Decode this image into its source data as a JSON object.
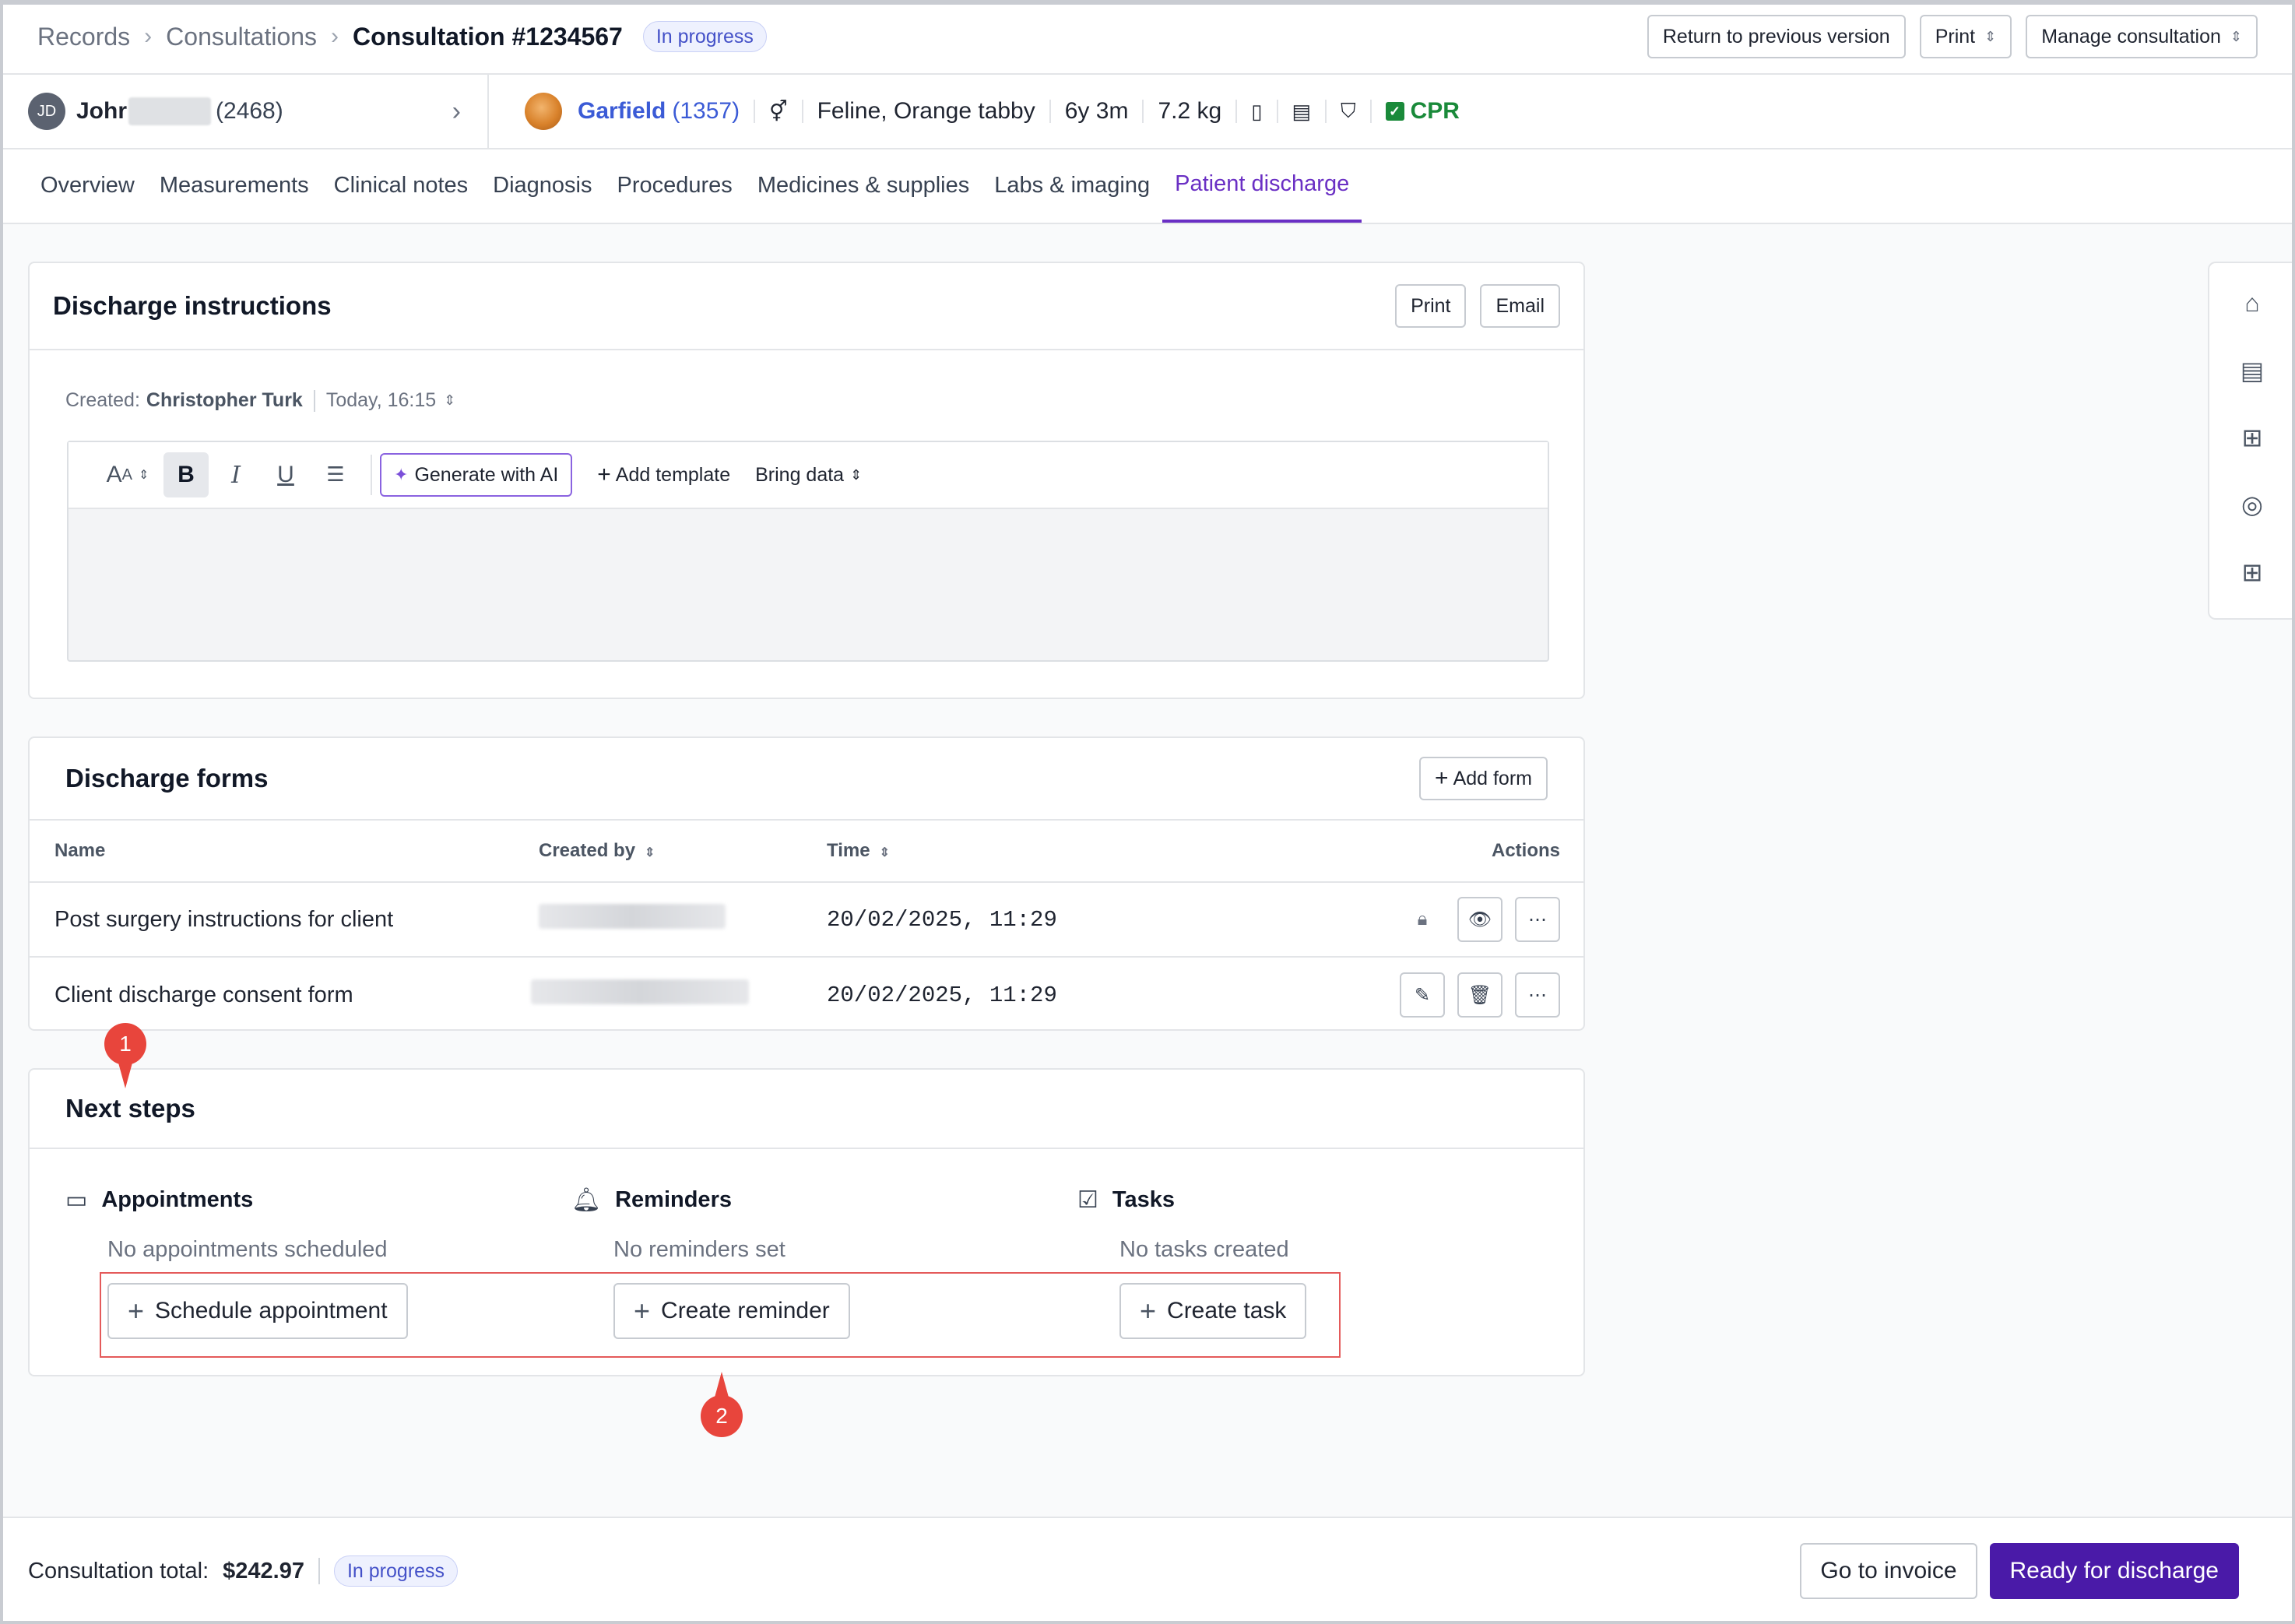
{
  "breadcrumb": {
    "items": [
      "Records",
      "Consultations"
    ],
    "current": "Consultation #1234567",
    "status": "In progress"
  },
  "header_actions": {
    "return_label": "Return to previous version",
    "print_label": "Print",
    "manage_label": "Manage consultation"
  },
  "client": {
    "initials": "JD",
    "name": "Johr",
    "id": "(2468)"
  },
  "patient": {
    "name": "Garfield",
    "id": "(1357)",
    "species": "Feline, Orange tabby",
    "age": "6y 3m",
    "weight": "7.2 kg",
    "cpr": "CPR"
  },
  "tabs": [
    "Overview",
    "Measurements",
    "Clinical notes",
    "Diagnosis",
    "Procedures",
    "Medicines & supplies",
    "Labs & imaging",
    "Patient discharge"
  ],
  "active_tab": "Patient discharge",
  "discharge_instructions": {
    "title": "Discharge instructions",
    "print_label": "Print",
    "email_label": "Email",
    "created_label": "Created:",
    "created_by": "Christopher Turk",
    "created_time": "Today, 16:15",
    "toolbar": {
      "generate_ai": "Generate with AI",
      "add_template": "Add template",
      "bring_data": "Bring data"
    }
  },
  "discharge_forms": {
    "title": "Discharge forms",
    "add_label": "Add form",
    "columns": [
      "Name",
      "Created by",
      "Time",
      "Actions"
    ],
    "rows": [
      {
        "name": "Post surgery instructions for client",
        "time": "20/02/2025, 11:29"
      },
      {
        "name": "Client discharge consent form",
        "time": "20/02/2025, 11:29"
      }
    ]
  },
  "next_steps": {
    "title": "Next steps",
    "appointments": {
      "title": "Appointments",
      "empty": "No appointments scheduled",
      "button": "Schedule appointment"
    },
    "reminders": {
      "title": "Reminders",
      "empty": "No reminders set",
      "button": "Create reminder"
    },
    "tasks": {
      "title": "Tasks",
      "empty": "No tasks created",
      "button": "Create task"
    }
  },
  "annotations": {
    "marker1": "1",
    "marker2": "2"
  },
  "footer": {
    "total_label": "Consultation total:",
    "total_value": "$242.97",
    "status": "In progress",
    "invoice_label": "Go to invoice",
    "discharge_label": "Ready for discharge"
  },
  "colors": {
    "accent": "#6a2fc4",
    "primary_button": "#4a1aa8",
    "link": "#3b5bd6",
    "cpr": "#1a8a3a",
    "marker": "#e8453c"
  }
}
